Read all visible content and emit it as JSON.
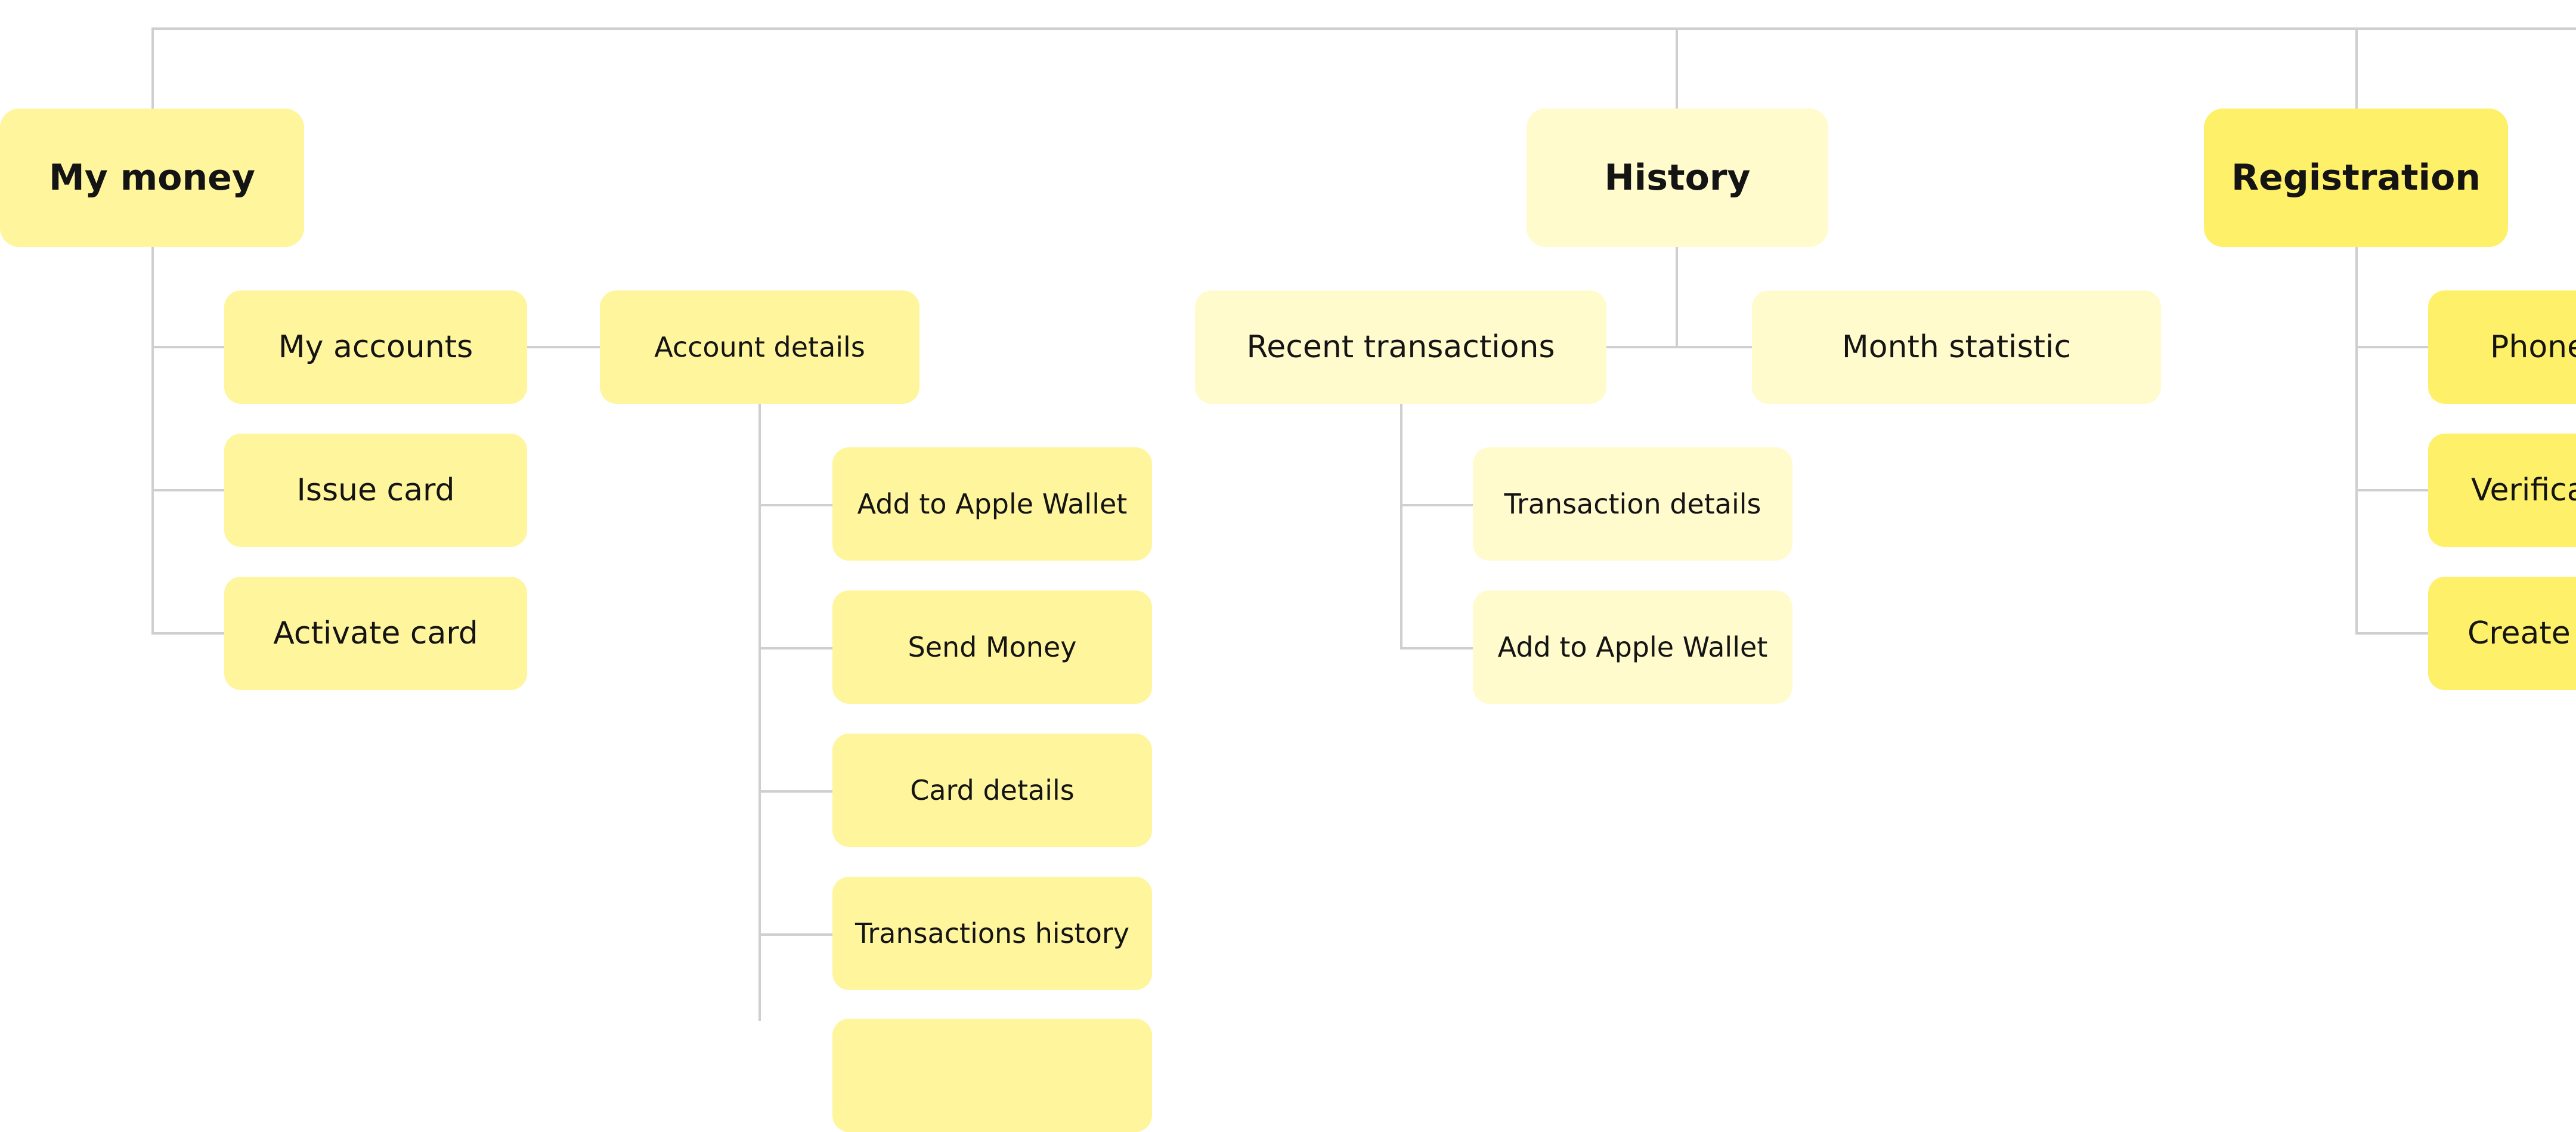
{
  "colors": {
    "my_money": "#fef59d",
    "history": "#fffbcd",
    "registration": "#fff06a",
    "connector": "#cfcfcf"
  },
  "sections": [
    {
      "title": "My money",
      "children": [
        "My accounts",
        "Issue card",
        "Activate card"
      ],
      "account_details": {
        "title": "Account details",
        "children": [
          "Add to Apple Wallet",
          "Send Money",
          "Card details",
          "Transactions history"
        ]
      }
    },
    {
      "title": "History",
      "children": [
        "Recent transactions",
        "Month statistic"
      ],
      "recent_children": [
        "Transaction details",
        "Add to Apple Wallet"
      ]
    },
    {
      "title": "Registration",
      "children": [
        "Phone",
        "Verifica",
        "Create"
      ]
    }
  ]
}
